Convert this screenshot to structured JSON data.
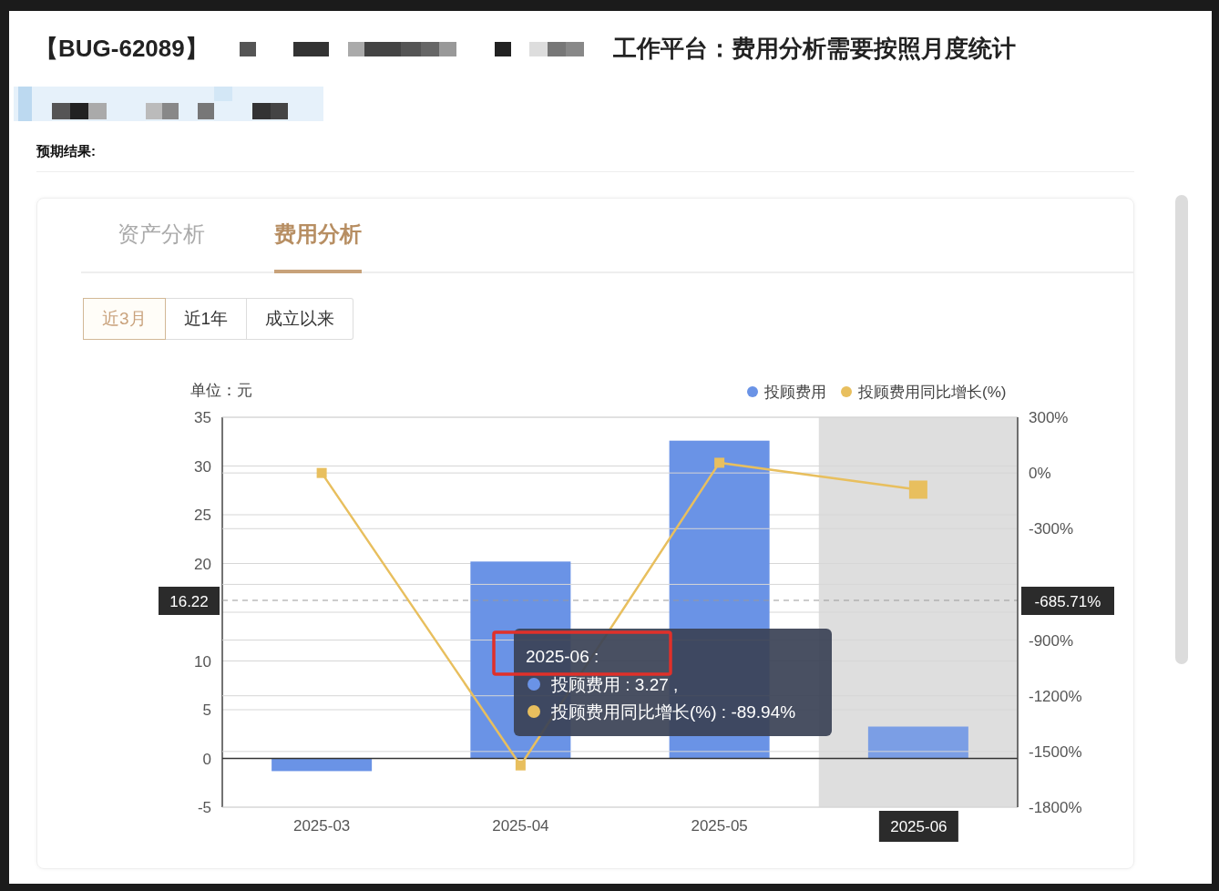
{
  "report": {
    "id": "【BUG-62089】",
    "title": "工作平台：费用分析需要按照月度统计",
    "section_label": "预期结果:"
  },
  "tabs": [
    {
      "label": "资产分析",
      "selected": false
    },
    {
      "label": "费用分析",
      "selected": true
    }
  ],
  "ranges": [
    {
      "label": "近3月",
      "selected": true
    },
    {
      "label": "近1年",
      "selected": false
    },
    {
      "label": "成立以来",
      "selected": false
    }
  ],
  "chart": {
    "hovered": [
      false,
      false,
      false,
      true
    ],
    "chart_data": {
      "type": "bar",
      "ylabel": "单位：元",
      "categories": [
        "2025-03",
        "2025-04",
        "2025-05",
        "2025-06"
      ],
      "series": [
        {
          "name": "投顾费用",
          "color": "#6a93e6",
          "values": [
            -1.3,
            20.2,
            32.6,
            3.27
          ]
        }
      ],
      "ylim": [
        -5,
        35
      ],
      "yticks": [
        -5,
        0,
        5,
        10,
        20,
        25,
        30,
        35
      ],
      "grid": true
    },
    "crosshair": {
      "left_label": "16.22",
      "right_label": "-685.71%"
    },
    "growth": {
      "chart_data": {
        "type": "line",
        "series": [
          {
            "name": "投顾费用同比增长(%)",
            "color": "#e8bf5e",
            "marker": "square",
            "values": [
              0,
              -1575,
              55,
              -89.94
            ]
          }
        ],
        "grid": true,
        "ylim": [
          -1800,
          300
        ],
        "yticks": [
          {
            "value": -1800,
            "label": "-1800%"
          },
          {
            "value": -1500,
            "label": "-1500%"
          },
          {
            "value": -1200,
            "label": "-1200%"
          },
          {
            "value": -900,
            "label": "-900%"
          },
          {
            "value": -300,
            "label": "-300%"
          },
          {
            "value": 0,
            "label": "0%"
          },
          {
            "value": 300,
            "label": "300%"
          }
        ]
      }
    },
    "tooltip": {
      "title": "2025-06 :",
      "rows": [
        {
          "text": "投顾费用 : 3.27 ,",
          "color": "#6a93e6"
        },
        {
          "text": "投顾费用同比增长(%) : -89.94%",
          "color": "#e8bf5e"
        }
      ]
    },
    "annotation": {
      "kind": "outline",
      "color": "#e0302a"
    }
  }
}
